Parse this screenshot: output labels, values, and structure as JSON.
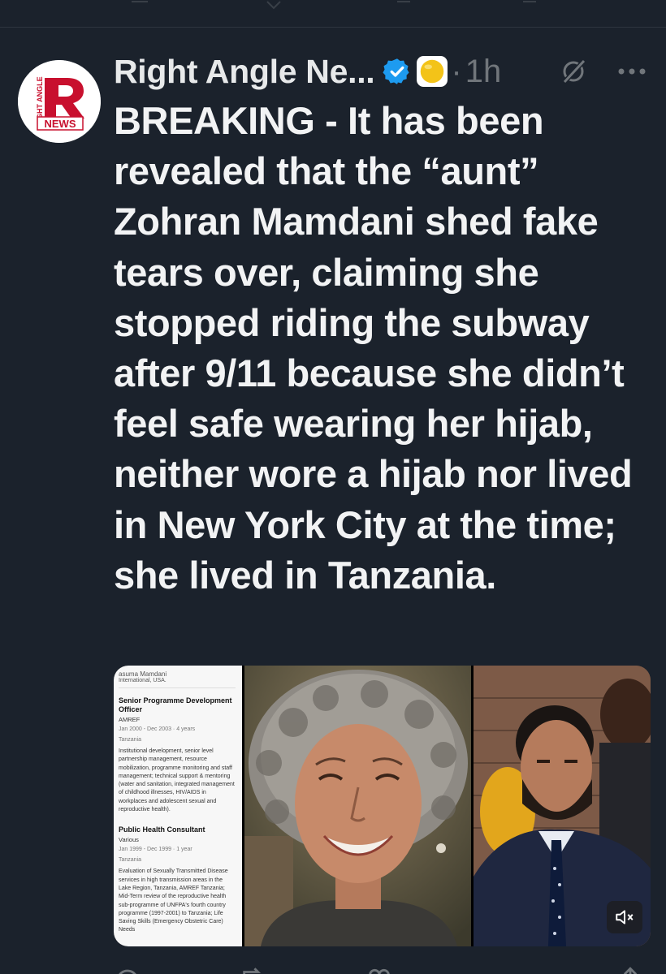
{
  "post": {
    "author_name": "Right Angle Ne...",
    "separator": "·",
    "time": "1h",
    "text": "BREAKING - It has been revealed that the “aunt” Zohran Mamdani shed fake tears over, claiming she stopped riding the subway after 9/11 because she didn’t feel safe wearing her hijab, neither wore a hijab nor lived in New York City at the time; she lived in Tanzania.",
    "avatar": {
      "logo_top": "RIGHT ANGLE",
      "logo_letter": "R",
      "logo_bottom": "NEWS"
    },
    "icons": {
      "verified": "verified-badge-icon",
      "emoji": "yellow-circle-emoji-icon",
      "grok": "grok-icon",
      "more": "more-icon",
      "mute": "mute-icon"
    },
    "colors": {
      "background": "#1b222c",
      "verified_blue": "#1d9bf0",
      "muted_text": "#71767b",
      "logo_red": "#c8102e"
    }
  },
  "media": {
    "resume": {
      "name": "asuma Mamdani",
      "location_line": "International, USA.",
      "entries": [
        {
          "title": "Senior Programme Development Officer",
          "org": "AMREF",
          "dates": "Jan 2000 - Dec 2003 · 4 years",
          "place": "Tanzania",
          "description": "Institutional development, senior level partnership management, resource mobilization, programme monitoring and staff management; technical support & mentoring (water and sanitation, integrated management of childhood illnesses, HIV/AIDS in workplaces and adolescent sexual and reproductive health)."
        },
        {
          "title": "Public Health Consultant",
          "org": "Various",
          "dates": "Jan 1999 - Dec 1999 · 1 year",
          "place": "Tanzania",
          "description": "Evaluation of Sexually Transmitted Disease services in high transmission areas in the Lake Region, Tanzania, AMREF Tanzania; Mid-Term review of the reproductive health sub-programme of UNFPA's fourth country programme (1997-2001) to Tanzania; Life Saving Skills (Emergency Obstetric Care) Needs"
        }
      ]
    }
  }
}
